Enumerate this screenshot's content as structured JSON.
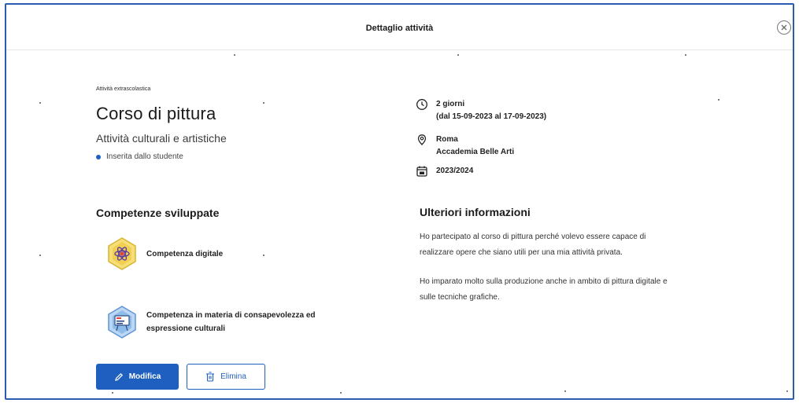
{
  "modal": {
    "title": "Dettaglio attività",
    "close_icon": "close-circle-icon"
  },
  "activity": {
    "category": "Attività extrascolastica",
    "title": "Corso di pittura",
    "subtitle": "Attività culturali e artistiche",
    "source": "Inserita dallo studente"
  },
  "competences": {
    "heading": "Competenze sviluppate",
    "items": [
      {
        "label": "Competenza digitale",
        "icon": "atom-icon"
      },
      {
        "label_line1": "Competenza in materia di consapevolezza ed",
        "label_line2": "espressione culturali",
        "icon": "easel-icon"
      }
    ]
  },
  "details": {
    "duration": "2 giorni",
    "dates": "(dal 15-09-2023 al 17-09-2023)",
    "city": "Roma",
    "place": "Accademia Belle Arti",
    "school_year": "2023/2024"
  },
  "more_info": {
    "heading": "Ulteriori informazioni",
    "paragraph1_line1": "Ho partecipato al corso di pittura perché volevo essere capace di",
    "paragraph1_line2": "realizzare opere che siano utili per una mia attività privata.",
    "paragraph2_line1": "Ho imparato molto sulla produzione anche in ambito di pittura digitale e",
    "paragraph2_line2": "sulle tecniche grafiche."
  },
  "actions": {
    "edit_label": "Modifica",
    "delete_label": "Elimina"
  },
  "colors": {
    "primary": "#1f5fbf",
    "border": "#2a5db0",
    "badge_yellow": "#f2d45c",
    "badge_blue": "#7fb0e6"
  }
}
